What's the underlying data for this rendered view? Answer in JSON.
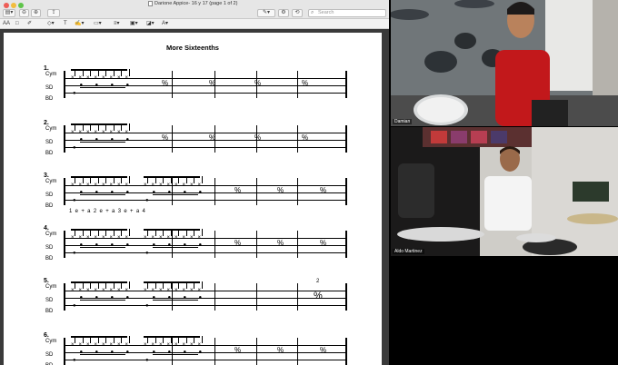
{
  "window": {
    "title": "Darione Appice- 16 y 17 (page 1 of 2)",
    "search_placeholder": "Search"
  },
  "markup": {
    "aa_label": "AA"
  },
  "sheet": {
    "title": "More Sixteenths",
    "row_labels": {
      "cym": "Cym",
      "sd": "SD",
      "bd": "BD"
    },
    "exercises": [
      {
        "number": "1."
      },
      {
        "number": "2."
      },
      {
        "number": "3.",
        "counting": "1  e  +  a  2  e  +  a  3  e  +  a  4"
      },
      {
        "number": "4."
      },
      {
        "number": "5.",
        "repeat_count": "2"
      },
      {
        "number": "6."
      }
    ]
  },
  "participants": [
    {
      "name": "Damian"
    },
    {
      "name": "Aldo Martinez"
    }
  ]
}
